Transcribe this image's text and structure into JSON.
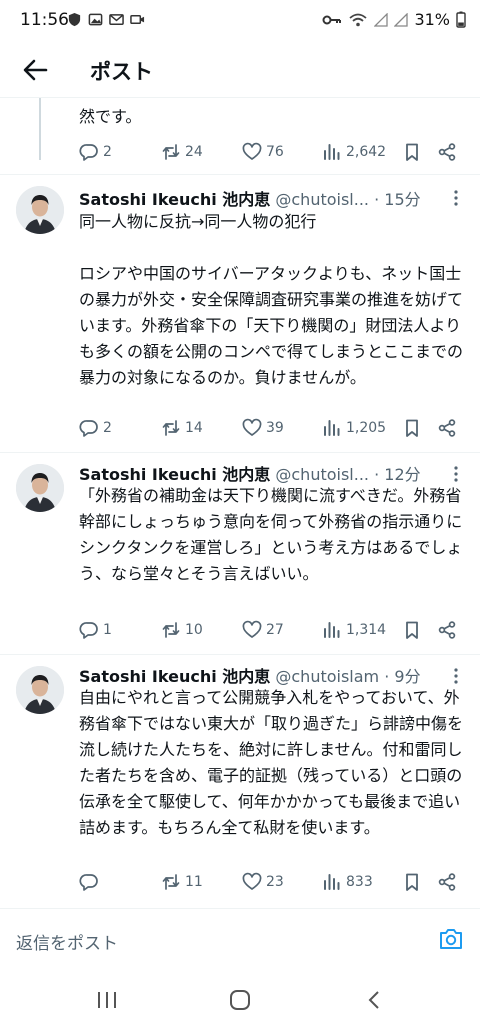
{
  "status": {
    "time": "11:56",
    "battery": "31%"
  },
  "header": {
    "title": "ポスト"
  },
  "fragment": {
    "text": "然です。",
    "actions": {
      "replies": "2",
      "reposts": "24",
      "likes": "76",
      "views": "2,642"
    }
  },
  "tweets": [
    {
      "name": "Satoshi Ikeuchi 池内恵",
      "handle": "@chutoisl...",
      "time": "· 15分",
      "text": "同一人物に反抗→同一人物の犯行\n\nロシアや中国のサイバーアタックよりも、ネット国士の暴力が外交・安全保障調査研究事業の推進を妨げています。外務省傘下の「天下り機関の」財団法人よりも多くの額を公開のコンペで得てしまうとここまでの暴力の対象になるのか。負けませんが。",
      "actions": {
        "replies": "2",
        "reposts": "14",
        "likes": "39",
        "views": "1,205"
      }
    },
    {
      "name": "Satoshi Ikeuchi 池内恵",
      "handle": "@chutoisl...",
      "time": "· 12分",
      "text": "「外務省の補助金は天下り機関に流すべきだ。外務省幹部にしょっちゅう意向を伺って外務省の指示通りにシンクタンクを運営しろ」という考え方はあるでしょう、なら堂々とそう言えばいい。",
      "actions": {
        "replies": "1",
        "reposts": "10",
        "likes": "27",
        "views": "1,314"
      }
    },
    {
      "name": "Satoshi Ikeuchi 池内恵",
      "handle": "@chutoislam",
      "time": "· 9分",
      "text": "自由にやれと言って公開競争入札をやっておいて、外務省傘下ではない東大が「取り過ぎた」ら誹謗中傷を流し続けた人たちを、絶対に許しません。付和雷同した者たちを含め、電子的証拠（残っている）と口頭の伝承を全て駆使して、何年かかかっても最後まで追い詰めます。もちろん全て私財を使います。",
      "actions": {
        "replies": "",
        "reposts": "11",
        "likes": "23",
        "views": "833"
      }
    }
  ],
  "reply": {
    "placeholder": "返信をポスト"
  },
  "colors": {
    "text": "#0f1419",
    "secondary": "#536471",
    "accent": "#1d9bf0",
    "divider": "#eff3f4"
  },
  "icons": [
    "back-arrow-icon",
    "reply-icon",
    "repost-icon",
    "like-icon",
    "views-icon",
    "bookmark-icon",
    "share-icon",
    "more-icon",
    "camera-icon",
    "recents-icon",
    "home-icon",
    "back-icon"
  ]
}
